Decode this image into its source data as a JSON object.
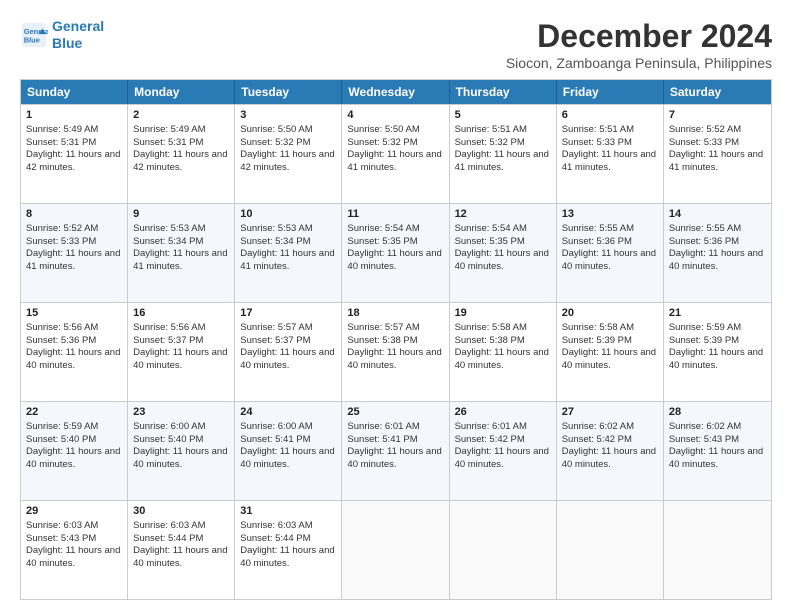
{
  "logo": {
    "line1": "General",
    "line2": "Blue"
  },
  "title": "December 2024",
  "subtitle": "Siocon, Zamboanga Peninsula, Philippines",
  "days": [
    "Sunday",
    "Monday",
    "Tuesday",
    "Wednesday",
    "Thursday",
    "Friday",
    "Saturday"
  ],
  "weeks": [
    [
      {
        "num": "1",
        "sunrise": "5:49 AM",
        "sunset": "5:31 PM",
        "daylight": "11 hours and 42 minutes."
      },
      {
        "num": "2",
        "sunrise": "5:49 AM",
        "sunset": "5:31 PM",
        "daylight": "11 hours and 42 minutes."
      },
      {
        "num": "3",
        "sunrise": "5:50 AM",
        "sunset": "5:32 PM",
        "daylight": "11 hours and 42 minutes."
      },
      {
        "num": "4",
        "sunrise": "5:50 AM",
        "sunset": "5:32 PM",
        "daylight": "11 hours and 41 minutes."
      },
      {
        "num": "5",
        "sunrise": "5:51 AM",
        "sunset": "5:32 PM",
        "daylight": "11 hours and 41 minutes."
      },
      {
        "num": "6",
        "sunrise": "5:51 AM",
        "sunset": "5:33 PM",
        "daylight": "11 hours and 41 minutes."
      },
      {
        "num": "7",
        "sunrise": "5:52 AM",
        "sunset": "5:33 PM",
        "daylight": "11 hours and 41 minutes."
      }
    ],
    [
      {
        "num": "8",
        "sunrise": "5:52 AM",
        "sunset": "5:33 PM",
        "daylight": "11 hours and 41 minutes."
      },
      {
        "num": "9",
        "sunrise": "5:53 AM",
        "sunset": "5:34 PM",
        "daylight": "11 hours and 41 minutes."
      },
      {
        "num": "10",
        "sunrise": "5:53 AM",
        "sunset": "5:34 PM",
        "daylight": "11 hours and 41 minutes."
      },
      {
        "num": "11",
        "sunrise": "5:54 AM",
        "sunset": "5:35 PM",
        "daylight": "11 hours and 40 minutes."
      },
      {
        "num": "12",
        "sunrise": "5:54 AM",
        "sunset": "5:35 PM",
        "daylight": "11 hours and 40 minutes."
      },
      {
        "num": "13",
        "sunrise": "5:55 AM",
        "sunset": "5:36 PM",
        "daylight": "11 hours and 40 minutes."
      },
      {
        "num": "14",
        "sunrise": "5:55 AM",
        "sunset": "5:36 PM",
        "daylight": "11 hours and 40 minutes."
      }
    ],
    [
      {
        "num": "15",
        "sunrise": "5:56 AM",
        "sunset": "5:36 PM",
        "daylight": "11 hours and 40 minutes."
      },
      {
        "num": "16",
        "sunrise": "5:56 AM",
        "sunset": "5:37 PM",
        "daylight": "11 hours and 40 minutes."
      },
      {
        "num": "17",
        "sunrise": "5:57 AM",
        "sunset": "5:37 PM",
        "daylight": "11 hours and 40 minutes."
      },
      {
        "num": "18",
        "sunrise": "5:57 AM",
        "sunset": "5:38 PM",
        "daylight": "11 hours and 40 minutes."
      },
      {
        "num": "19",
        "sunrise": "5:58 AM",
        "sunset": "5:38 PM",
        "daylight": "11 hours and 40 minutes."
      },
      {
        "num": "20",
        "sunrise": "5:58 AM",
        "sunset": "5:39 PM",
        "daylight": "11 hours and 40 minutes."
      },
      {
        "num": "21",
        "sunrise": "5:59 AM",
        "sunset": "5:39 PM",
        "daylight": "11 hours and 40 minutes."
      }
    ],
    [
      {
        "num": "22",
        "sunrise": "5:59 AM",
        "sunset": "5:40 PM",
        "daylight": "11 hours and 40 minutes."
      },
      {
        "num": "23",
        "sunrise": "6:00 AM",
        "sunset": "5:40 PM",
        "daylight": "11 hours and 40 minutes."
      },
      {
        "num": "24",
        "sunrise": "6:00 AM",
        "sunset": "5:41 PM",
        "daylight": "11 hours and 40 minutes."
      },
      {
        "num": "25",
        "sunrise": "6:01 AM",
        "sunset": "5:41 PM",
        "daylight": "11 hours and 40 minutes."
      },
      {
        "num": "26",
        "sunrise": "6:01 AM",
        "sunset": "5:42 PM",
        "daylight": "11 hours and 40 minutes."
      },
      {
        "num": "27",
        "sunrise": "6:02 AM",
        "sunset": "5:42 PM",
        "daylight": "11 hours and 40 minutes."
      },
      {
        "num": "28",
        "sunrise": "6:02 AM",
        "sunset": "5:43 PM",
        "daylight": "11 hours and 40 minutes."
      }
    ],
    [
      {
        "num": "29",
        "sunrise": "6:03 AM",
        "sunset": "5:43 PM",
        "daylight": "11 hours and 40 minutes."
      },
      {
        "num": "30",
        "sunrise": "6:03 AM",
        "sunset": "5:44 PM",
        "daylight": "11 hours and 40 minutes."
      },
      {
        "num": "31",
        "sunrise": "6:03 AM",
        "sunset": "5:44 PM",
        "daylight": "11 hours and 40 minutes."
      },
      null,
      null,
      null,
      null
    ]
  ]
}
